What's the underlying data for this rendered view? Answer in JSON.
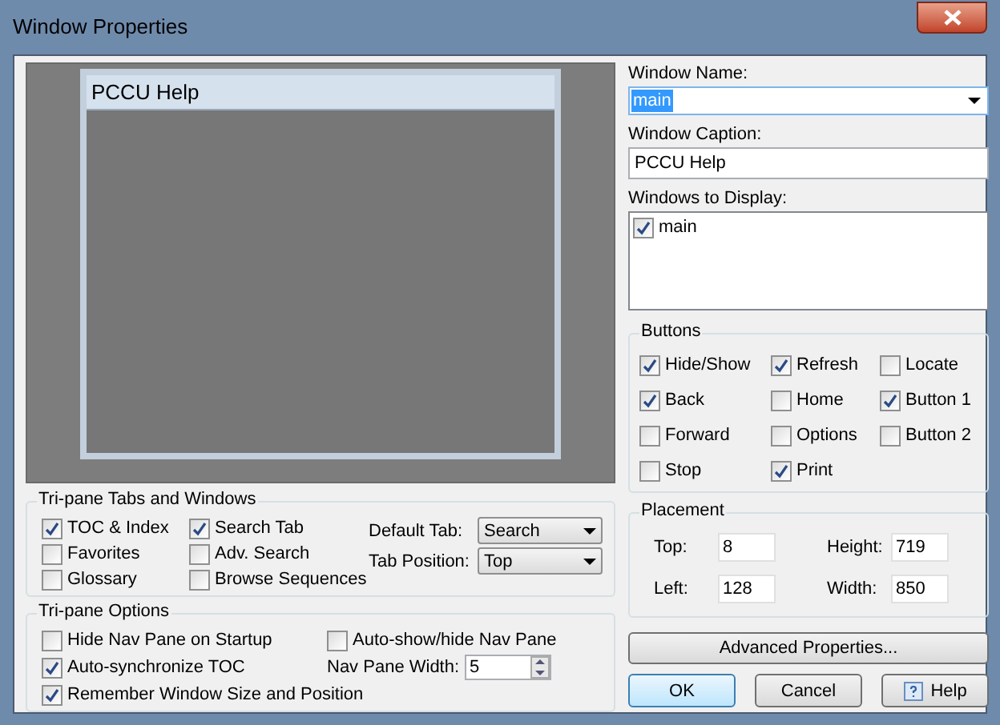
{
  "window": {
    "title": "Window Properties"
  },
  "preview": {
    "caption": "PCCU Help"
  },
  "tri_pane_tabs": {
    "title": "Tri-pane Tabs and Windows",
    "checkboxes": [
      {
        "label": "TOC & Index",
        "checked": true
      },
      {
        "label": "Search Tab",
        "checked": true
      },
      {
        "label": "Favorites",
        "checked": false
      },
      {
        "label": "Adv. Search",
        "checked": false
      },
      {
        "label": "Glossary",
        "checked": false
      },
      {
        "label": "Browse Sequences",
        "checked": false
      }
    ],
    "dropdowns": [
      {
        "label": "Default Tab:",
        "value": "Search"
      },
      {
        "label": "Tab Position:",
        "value": "Top"
      }
    ]
  },
  "tri_pane_options": {
    "title": "Tri-pane Options",
    "checkboxes": [
      {
        "label": "Hide Nav Pane on Startup",
        "checked": false
      },
      {
        "label": "Auto-show/hide Nav Pane",
        "checked": false
      },
      {
        "label": "Auto-synchronize TOC",
        "checked": true
      },
      {
        "label": "Remember Window Size and Position",
        "checked": true
      }
    ],
    "nav_pane_width": {
      "label": "Nav Pane Width:",
      "value": "5"
    }
  },
  "window_name": {
    "label": "Window Name:",
    "value": "main"
  },
  "window_caption": {
    "label": "Window Caption:",
    "value": "PCCU Help"
  },
  "windows_to_display": {
    "label": "Windows to Display:",
    "items": [
      {
        "label": "main",
        "checked": true
      }
    ]
  },
  "buttons_group": {
    "title": "Buttons",
    "checkboxes": [
      {
        "label": "Hide/Show",
        "checked": true
      },
      {
        "label": "Refresh",
        "checked": true
      },
      {
        "label": "Locate",
        "checked": false
      },
      {
        "label": "Back",
        "checked": true
      },
      {
        "label": "Home",
        "checked": false
      },
      {
        "label": "Button 1",
        "checked": true
      },
      {
        "label": "Forward",
        "checked": false
      },
      {
        "label": "Options",
        "checked": false
      },
      {
        "label": "Button 2",
        "checked": false
      },
      {
        "label": "Stop",
        "checked": false
      },
      {
        "label": "Print",
        "checked": true
      }
    ]
  },
  "placement": {
    "title": "Placement",
    "fields": [
      {
        "label": "Top:",
        "value": "8"
      },
      {
        "label": "Height:",
        "value": "719"
      },
      {
        "label": "Left:",
        "value": "128"
      },
      {
        "label": "Width:",
        "value": "850"
      }
    ]
  },
  "advanced_button": "Advanced Properties...",
  "dialog_buttons": [
    {
      "label": "OK",
      "kind": "default"
    },
    {
      "label": "Cancel",
      "kind": "plain"
    },
    {
      "label": "Help",
      "kind": "help"
    }
  ]
}
